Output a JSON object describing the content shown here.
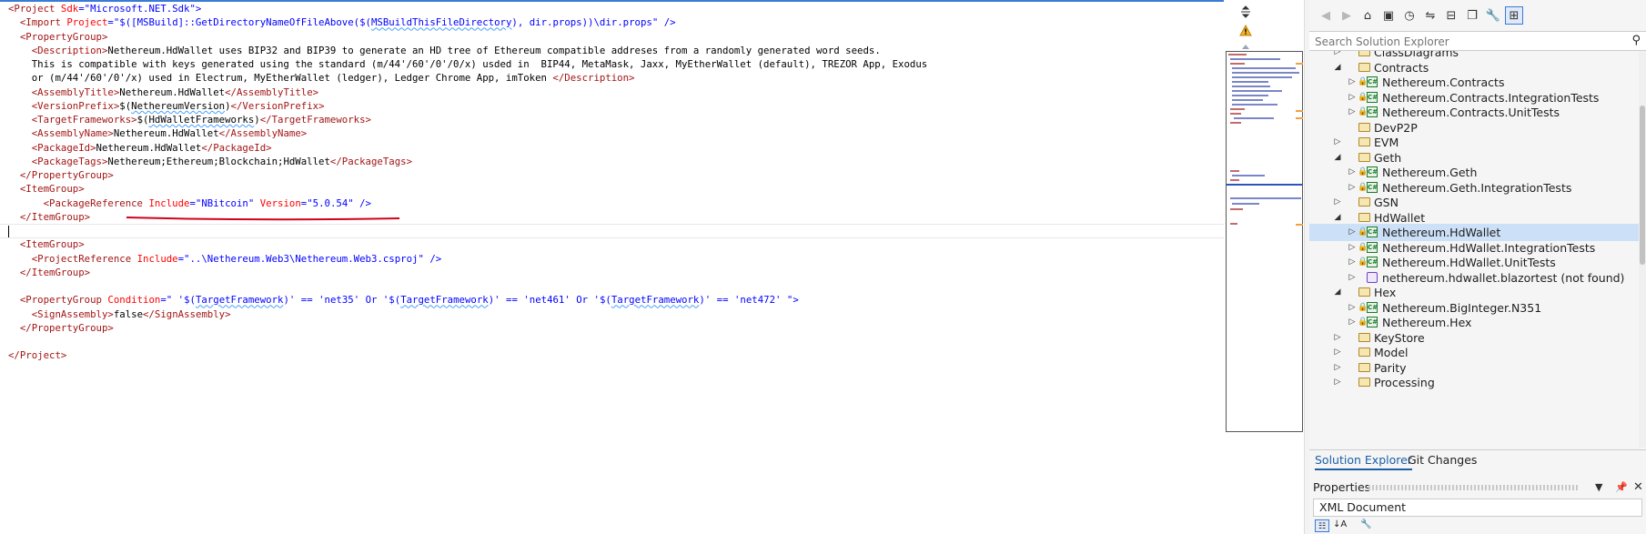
{
  "editor": {
    "lines": [
      [
        [
          "tg",
          "<Project "
        ],
        [
          "at",
          "Sdk"
        ],
        [
          "bl",
          "=\""
        ],
        [
          "vl",
          "Microsoft.NET.Sdk"
        ],
        [
          "bl",
          "\">"
        ]
      ],
      [
        [
          "tx",
          "  "
        ],
        [
          "tg",
          "<Import "
        ],
        [
          "at",
          "Project"
        ],
        [
          "bl",
          "=\""
        ],
        [
          "vl",
          "$([MSBuild]::GetDirectoryNameOfFileAbove($("
        ],
        [
          "vls",
          "MSBuildThisFileDirectory"
        ],
        [
          "vl",
          "), dir.props))\\dir.props"
        ],
        [
          "bl",
          "\" />"
        ]
      ],
      [
        [
          "tx",
          "  "
        ],
        [
          "tg",
          "<PropertyGroup>"
        ]
      ],
      [
        [
          "tx",
          "    "
        ],
        [
          "tg",
          "<Description>"
        ],
        [
          "tx",
          "Nethereum.HdWallet uses BIP32 and BIP39 to generate an HD tree of Ethereum compatible addreses from a randomly generated word seeds."
        ]
      ],
      [
        [
          "tx",
          "    This is compatible with keys generated using the standard (m/44'/60'/0'/0/x) usded in  BIP44, MetaMask, Jaxx, MyEtherWallet (default), TREZOR App, Exodus"
        ]
      ],
      [
        [
          "tx",
          "    or (m/44'/60'/0'/x) used in Electrum, MyEtherWallet (ledger), Ledger Chrome App, imToken "
        ],
        [
          "tg",
          "</Description>"
        ]
      ],
      [
        [
          "tx",
          "    "
        ],
        [
          "tg",
          "<AssemblyTitle>"
        ],
        [
          "tx",
          "Nethereum.HdWallet"
        ],
        [
          "tg",
          "</AssemblyTitle>"
        ]
      ],
      [
        [
          "tx",
          "    "
        ],
        [
          "tg",
          "<VersionPrefix>"
        ],
        [
          "tx",
          "$("
        ],
        [
          "txs",
          "NethereumVersion"
        ],
        [
          "tx",
          ")"
        ],
        [
          "tg",
          "</VersionPrefix>"
        ]
      ],
      [
        [
          "tx",
          "    "
        ],
        [
          "tg",
          "<TargetFrameworks>"
        ],
        [
          "tx",
          "$("
        ],
        [
          "txs",
          "HdWalletFrameworks"
        ],
        [
          "tx",
          ")"
        ],
        [
          "tg",
          "</TargetFrameworks>"
        ]
      ],
      [
        [
          "tx",
          "    "
        ],
        [
          "tg",
          "<AssemblyName>"
        ],
        [
          "tx",
          "Nethereum.HdWallet"
        ],
        [
          "tg",
          "</AssemblyName>"
        ]
      ],
      [
        [
          "tx",
          "    "
        ],
        [
          "tg",
          "<PackageId>"
        ],
        [
          "tx",
          "Nethereum.HdWallet"
        ],
        [
          "tg",
          "</PackageId>"
        ]
      ],
      [
        [
          "tx",
          "    "
        ],
        [
          "tg",
          "<PackageTags>"
        ],
        [
          "tx",
          "Nethereum;Ethereum;Blockchain;HdWallet"
        ],
        [
          "tg",
          "</PackageTags>"
        ]
      ],
      [
        [
          "tx",
          "  "
        ],
        [
          "tg",
          "</PropertyGroup>"
        ]
      ],
      [
        [
          "tx",
          "  "
        ],
        [
          "tg",
          "<ItemGroup>"
        ]
      ],
      [
        [
          "tx",
          "      "
        ],
        [
          "tg",
          "<PackageReference "
        ],
        [
          "at",
          "Include"
        ],
        [
          "bl",
          "=\""
        ],
        [
          "vl",
          "NBitcoin"
        ],
        [
          "bl",
          "\" "
        ],
        [
          "at",
          "Version"
        ],
        [
          "bl",
          "=\""
        ],
        [
          "vl",
          "5.0.54"
        ],
        [
          "bl",
          "\" />"
        ]
      ],
      [
        [
          "tx",
          "  "
        ],
        [
          "tg",
          "</ItemGroup>"
        ]
      ],
      [
        [
          "tx",
          ""
        ]
      ],
      [
        [
          "tx",
          "  "
        ],
        [
          "tg",
          "<ItemGroup>"
        ]
      ],
      [
        [
          "tx",
          "    "
        ],
        [
          "tg",
          "<ProjectReference "
        ],
        [
          "at",
          "Include"
        ],
        [
          "bl",
          "=\""
        ],
        [
          "vl",
          "..\\Nethereum.Web3\\Nethereum.Web3.csproj"
        ],
        [
          "bl",
          "\" />"
        ]
      ],
      [
        [
          "tx",
          "  "
        ],
        [
          "tg",
          "</ItemGroup>"
        ]
      ],
      [
        [
          "tx",
          ""
        ]
      ],
      [
        [
          "tx",
          "  "
        ],
        [
          "tg",
          "<PropertyGroup "
        ],
        [
          "at",
          "Condition"
        ],
        [
          "bl",
          "=\""
        ],
        [
          "vl",
          " '$("
        ],
        [
          "vls",
          "TargetFramework"
        ],
        [
          "vl",
          ")' == 'net35' Or '$("
        ],
        [
          "vls",
          "TargetFramework"
        ],
        [
          "vl",
          ")' == 'net461' Or '$("
        ],
        [
          "vls",
          "TargetFramework"
        ],
        [
          "vl",
          ")' == 'net472' "
        ],
        [
          "bl",
          "\">"
        ]
      ],
      [
        [
          "tx",
          "    "
        ],
        [
          "tg",
          "<SignAssembly>"
        ],
        [
          "tx",
          "false"
        ],
        [
          "tg",
          "</SignAssembly>"
        ]
      ],
      [
        [
          "tx",
          "  "
        ],
        [
          "tg",
          "</PropertyGroup>"
        ]
      ],
      [
        [
          "tx",
          ""
        ]
      ],
      [
        [
          "tg",
          "</Project>"
        ]
      ]
    ]
  },
  "explorer": {
    "search_placeholder": "Search Solution Explorer",
    "tree": [
      {
        "label": "ClassDiagrams",
        "type": "folder",
        "level": 0,
        "expanded": false
      },
      {
        "label": "Contracts",
        "type": "folder",
        "level": 0,
        "expanded": true
      },
      {
        "label": "Nethereum.Contracts",
        "type": "project",
        "level": 1
      },
      {
        "label": "Nethereum.Contracts.IntegrationTests",
        "type": "project",
        "level": 1
      },
      {
        "label": "Nethereum.Contracts.UnitTests",
        "type": "project",
        "level": 1
      },
      {
        "label": "DevP2P",
        "type": "folder",
        "level": 0,
        "expanded": null
      },
      {
        "label": "EVM",
        "type": "folder",
        "level": 0,
        "expanded": false
      },
      {
        "label": "Geth",
        "type": "folder",
        "level": 0,
        "expanded": true
      },
      {
        "label": "Nethereum.Geth",
        "type": "project",
        "level": 1
      },
      {
        "label": "Nethereum.Geth.IntegrationTests",
        "type": "project",
        "level": 1
      },
      {
        "label": "GSN",
        "type": "folder",
        "level": 0,
        "expanded": false
      },
      {
        "label": "HdWallet",
        "type": "folder",
        "level": 0,
        "expanded": true
      },
      {
        "label": "Nethereum.HdWallet",
        "type": "project",
        "level": 1,
        "selected": true
      },
      {
        "label": "Nethereum.HdWallet.IntegrationTests",
        "type": "project",
        "level": 1
      },
      {
        "label": "Nethereum.HdWallet.UnitTests",
        "type": "project",
        "level": 1
      },
      {
        "label": "nethereum.hdwallet.blazortest (not found)",
        "type": "blazor",
        "level": 1
      },
      {
        "label": "Hex",
        "type": "folder",
        "level": 0,
        "expanded": true
      },
      {
        "label": "Nethereum.BigInteger.N351",
        "type": "project",
        "level": 1
      },
      {
        "label": "Nethereum.Hex",
        "type": "project",
        "level": 1
      },
      {
        "label": "KeyStore",
        "type": "folder",
        "level": 0,
        "expanded": false
      },
      {
        "label": "Model",
        "type": "folder",
        "level": 0,
        "expanded": false
      },
      {
        "label": "Parity",
        "type": "folder",
        "level": 0,
        "expanded": false
      },
      {
        "label": "Processing",
        "type": "folder",
        "level": 0,
        "expanded": false
      }
    ],
    "tabs": {
      "solution_explorer": "Solution Explorer",
      "git_changes": "Git Changes"
    },
    "properties": {
      "title": "Properties",
      "selected_type": "XML Document"
    }
  },
  "colors": {
    "accent": "#1a5ea8",
    "selection": "#cce0f7",
    "annotation": "#d0021b"
  }
}
